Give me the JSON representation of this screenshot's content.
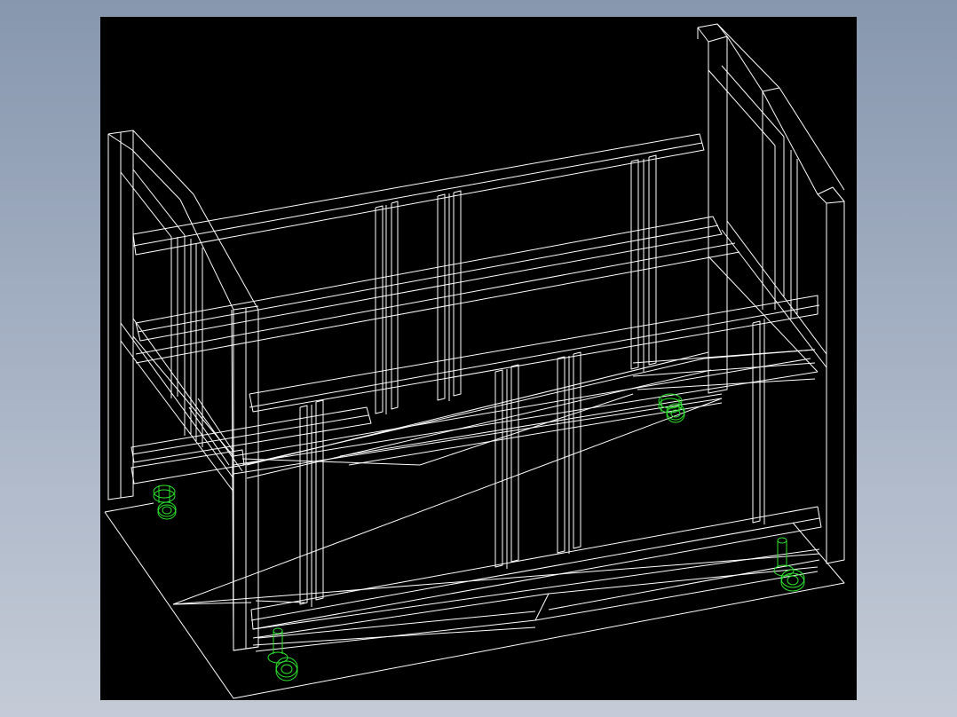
{
  "app": {
    "title": ""
  },
  "viewport": {
    "background": "#000000",
    "page_background": "#97a4b8",
    "drawing": "wireframe-crib-with-casters"
  },
  "colors": {
    "frame_lines": "#ffffff",
    "caster_lines": "#2de62d"
  },
  "parts": {
    "left_headboard": "left-headboard",
    "right_headboard": "right-headboard",
    "back_side_rails": "back-side-rails",
    "front_side_panel": "front-side-panel",
    "bottom_base": "bottom-base",
    "casters": [
      "caster-left-back",
      "caster-right-back",
      "caster-right-front",
      "caster-left-front"
    ]
  }
}
